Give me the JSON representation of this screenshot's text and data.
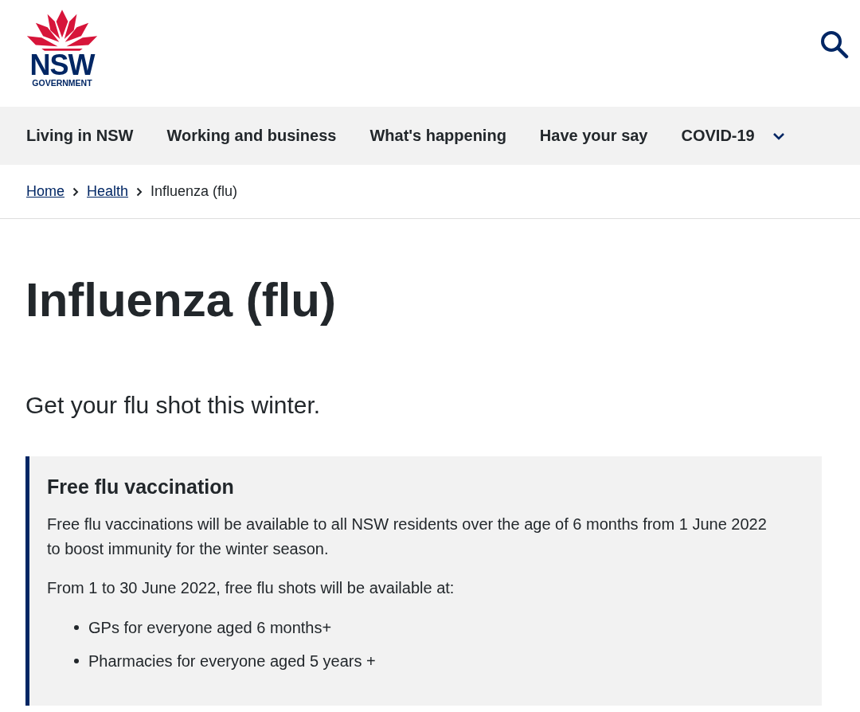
{
  "header": {
    "logo": {
      "wordmark": "NSW",
      "subtitle": "GOVERNMENT"
    }
  },
  "nav": {
    "items": [
      {
        "label": "Living in NSW",
        "has_menu": false
      },
      {
        "label": "Working and business",
        "has_menu": false
      },
      {
        "label": "What's happening",
        "has_menu": false
      },
      {
        "label": "Have your say",
        "has_menu": false
      },
      {
        "label": "COVID-19",
        "has_menu": true
      }
    ]
  },
  "breadcrumb": {
    "links": [
      "Home",
      "Health"
    ],
    "current": "Influenza (flu)"
  },
  "title": "Influenza (flu)",
  "intro": "Get your flu shot this winter.",
  "callout": {
    "heading": "Free flu vaccination",
    "paragraphs": [
      "Free flu vaccinations will be available to all NSW residents over the age of 6 months from 1 June 2022 to boost immunity for the winter season.",
      "From 1 to 30 June 2022, free flu shots will be available at:"
    ],
    "list": [
      "GPs for everyone aged 6 months+",
      "Pharmacies for everyone aged 5 years +"
    ]
  }
}
